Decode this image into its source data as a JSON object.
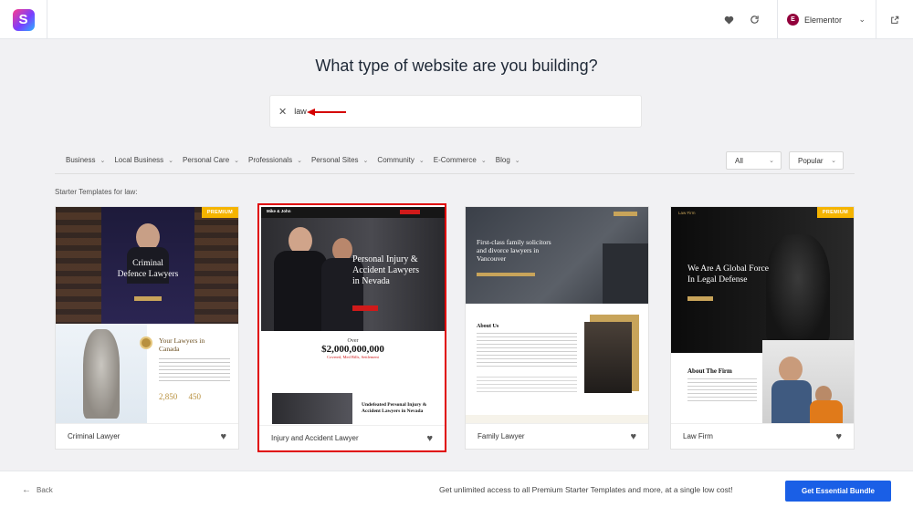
{
  "app": {
    "logo_letter": "S",
    "builder_badge": "E",
    "builder_name": "Elementor"
  },
  "icons": {
    "favorites": "heart-icon",
    "sync": "refresh-icon",
    "builder_dropdown": "chevron-down-icon",
    "exit": "external-link-icon"
  },
  "heading": "What type of website are you building?",
  "search": {
    "value": "law",
    "clear_icon": "close-icon"
  },
  "categories": [
    "Business",
    "Local Business",
    "Personal Care",
    "Professionals",
    "Personal Sites",
    "Community",
    "E-Commerce",
    "Blog"
  ],
  "filters": {
    "type_selected": "All",
    "sort_selected": "Popular"
  },
  "results_label": "Starter Templates for law:",
  "cards": [
    {
      "name": "Criminal Lawyer",
      "badge": "PREMIUM",
      "hero_title_1": "Criminal",
      "hero_title_2": "Defence Lawyers",
      "section_title_1": "Your Lawyers in",
      "section_title_2": "Canada",
      "stat_1": "2,850",
      "stat_2": "450"
    },
    {
      "name": "Injury and Accident Lawyer",
      "brand": "Mike & John",
      "hero_title_1": "Personal Injury &",
      "hero_title_2": "Accident Lawyers",
      "hero_title_3": "in Nevada",
      "over": "Over",
      "amount": "$2,000,000,000",
      "amount_caption": "Covered, Med Bills, Settlement",
      "section_title_1": "Undefeated Personal Injury &",
      "section_title_2": "Accident Lawyers in Nevada"
    },
    {
      "name": "Family Lawyer",
      "hero_title_1": "First-class family solicitors",
      "hero_title_2": "and divorce lawyers in",
      "hero_title_3": "Vancouver",
      "section_title": "About Us"
    },
    {
      "name": "Law Firm",
      "badge": "PREMIUM",
      "brand": "Law Firm",
      "hero_title_1": "We Are A Global Force",
      "hero_title_2": "In Legal Defense",
      "section_title": "About The Firm"
    }
  ],
  "footer": {
    "back_label": "Back",
    "promo_text": "Get unlimited access to all Premium Starter Templates and more, at a single low cost!",
    "cta_label": "Get Essential Bundle"
  },
  "colors": {
    "accent": "#1a5fe6",
    "premium": "#f5b400",
    "selected_border": "#e00000",
    "annotation_arrow": "#d40000"
  }
}
